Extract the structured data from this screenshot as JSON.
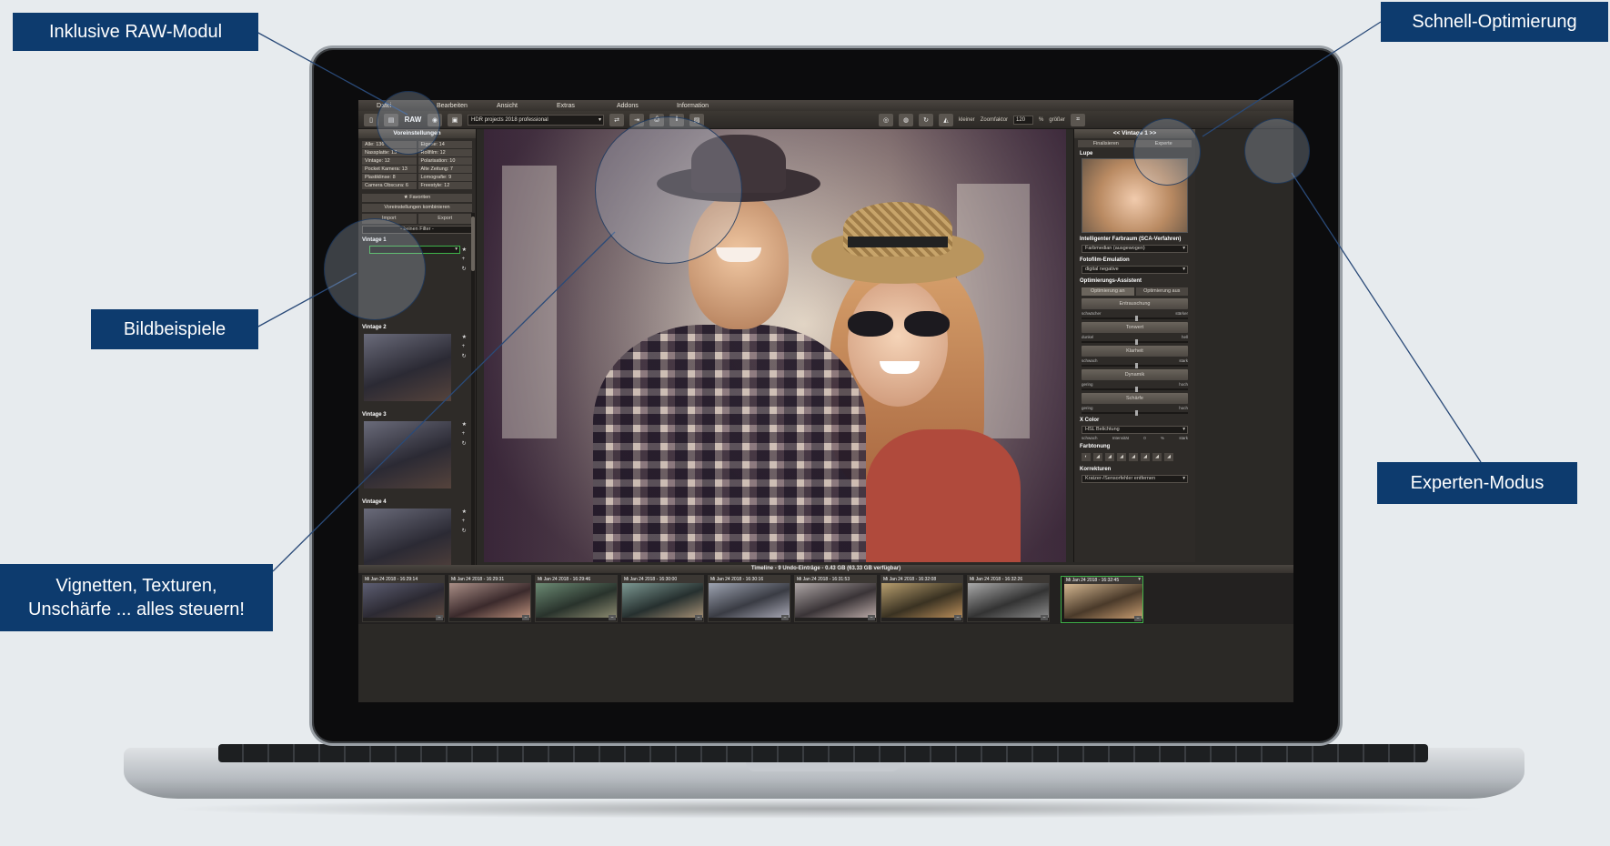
{
  "callouts": {
    "raw": "Inklusive RAW-Modul",
    "schnell": "Schnell-Optimierung",
    "bildbeispiele": "Bildbeispiele",
    "experten": "Experten-Modus",
    "vignetten_line1": "Vignetten, Texturen,",
    "vignetten_line2": "Unschärfe ... alles steuern!"
  },
  "menu": [
    "Datei",
    "Bearbeiten",
    "Ansicht",
    "Extras",
    "Addons",
    "Information"
  ],
  "toolbar": {
    "raw_label": "RAW",
    "preset": "HDR projects 2018 professional",
    "zoom_small": "kleiner",
    "zoom_label": "Zoomfaktor",
    "zoom_value": "120",
    "zoom_unit": "%",
    "zoom_large": "größer"
  },
  "left": {
    "title": "Voreinstellungen",
    "categories": [
      "Alle: 136",
      "Eigene: 14",
      "Nassplatte: 13",
      "Rollfilm: 12",
      "Vintage: 12",
      "Polarisation: 10",
      "Pocket Kamera: 13",
      "Alte Zeitung: 7",
      "Plastiklinse: 8",
      "Lomografie: 9",
      "Camera Obscura: 6",
      "Freestyle: 12"
    ],
    "favorites": "★ Favoriten",
    "combine": "Voreinstellungen kombinieren",
    "import": "Import",
    "export": "Export",
    "filter": "- keinen Filter -",
    "vintages": [
      "Vintage 1",
      "Vintage 2",
      "Vintage 3",
      "Vintage 4"
    ]
  },
  "right": {
    "title": "<< Vintage 1 >>",
    "tab_final": "Finalisieren",
    "tab_expert": "Experte",
    "lupe": "Lupe",
    "farbraum_title": "Intelligenter Farbraum (SCA-Verfahren)",
    "farbraum_value": "Farbmedian (ausgewogen)",
    "film_title": "Fotofilm-Emulation",
    "film_value": "digital negative",
    "assist_title": "Optimierungs-Assistent",
    "opt_on": "Optimierung an",
    "opt_off": "Optimierung aus",
    "sliders": [
      {
        "label": "Entrauschung",
        "left": "schwächer",
        "right": "stärker"
      },
      {
        "label": "Tonwert",
        "left": "dunkel",
        "right": "hell"
      },
      {
        "label": "Klarheit",
        "left": "schwach",
        "right": "stark"
      },
      {
        "label": "Dynamik",
        "left": "gering",
        "right": "hoch"
      },
      {
        "label": "Schärfe",
        "left": "gering",
        "right": "hoch"
      }
    ],
    "xcolor_title": "X Color",
    "xcolor_value": "HSL Belichtung",
    "xcolor_left": "schwach",
    "xcolor_mid": "Intensität",
    "xcolor_val": "0",
    "xcolor_pct": "%",
    "xcolor_right": "stark",
    "farbtonung": "Farbtonung",
    "korrekturen": "Korrekturen",
    "korr_value": "Kratzer-/Sensorfehler entfernen"
  },
  "timeline": {
    "title": "Timeline - 9 Undo-Einträge - 0.43 GB (63.33 GB verfügbar)",
    "items": [
      "Mi Jan 24 2018 - 16:29:14",
      "Mi Jan 24 2018 - 16:29:31",
      "Mi Jan 24 2018 - 16:29:46",
      "Mi Jan 24 2018 - 16:30:00",
      "Mi Jan 24 2018 - 16:30:16",
      "Mi Jan 24 2018 - 16:31:53",
      "Mi Jan 24 2018 - 16:32:08",
      "Mi Jan 24 2018 - 16:32:26",
      "Mi Jan 24 2018 - 16:32:45"
    ]
  },
  "colors": {
    "callout_bg": "#0d3b6e",
    "selection": "#3fb34a"
  }
}
